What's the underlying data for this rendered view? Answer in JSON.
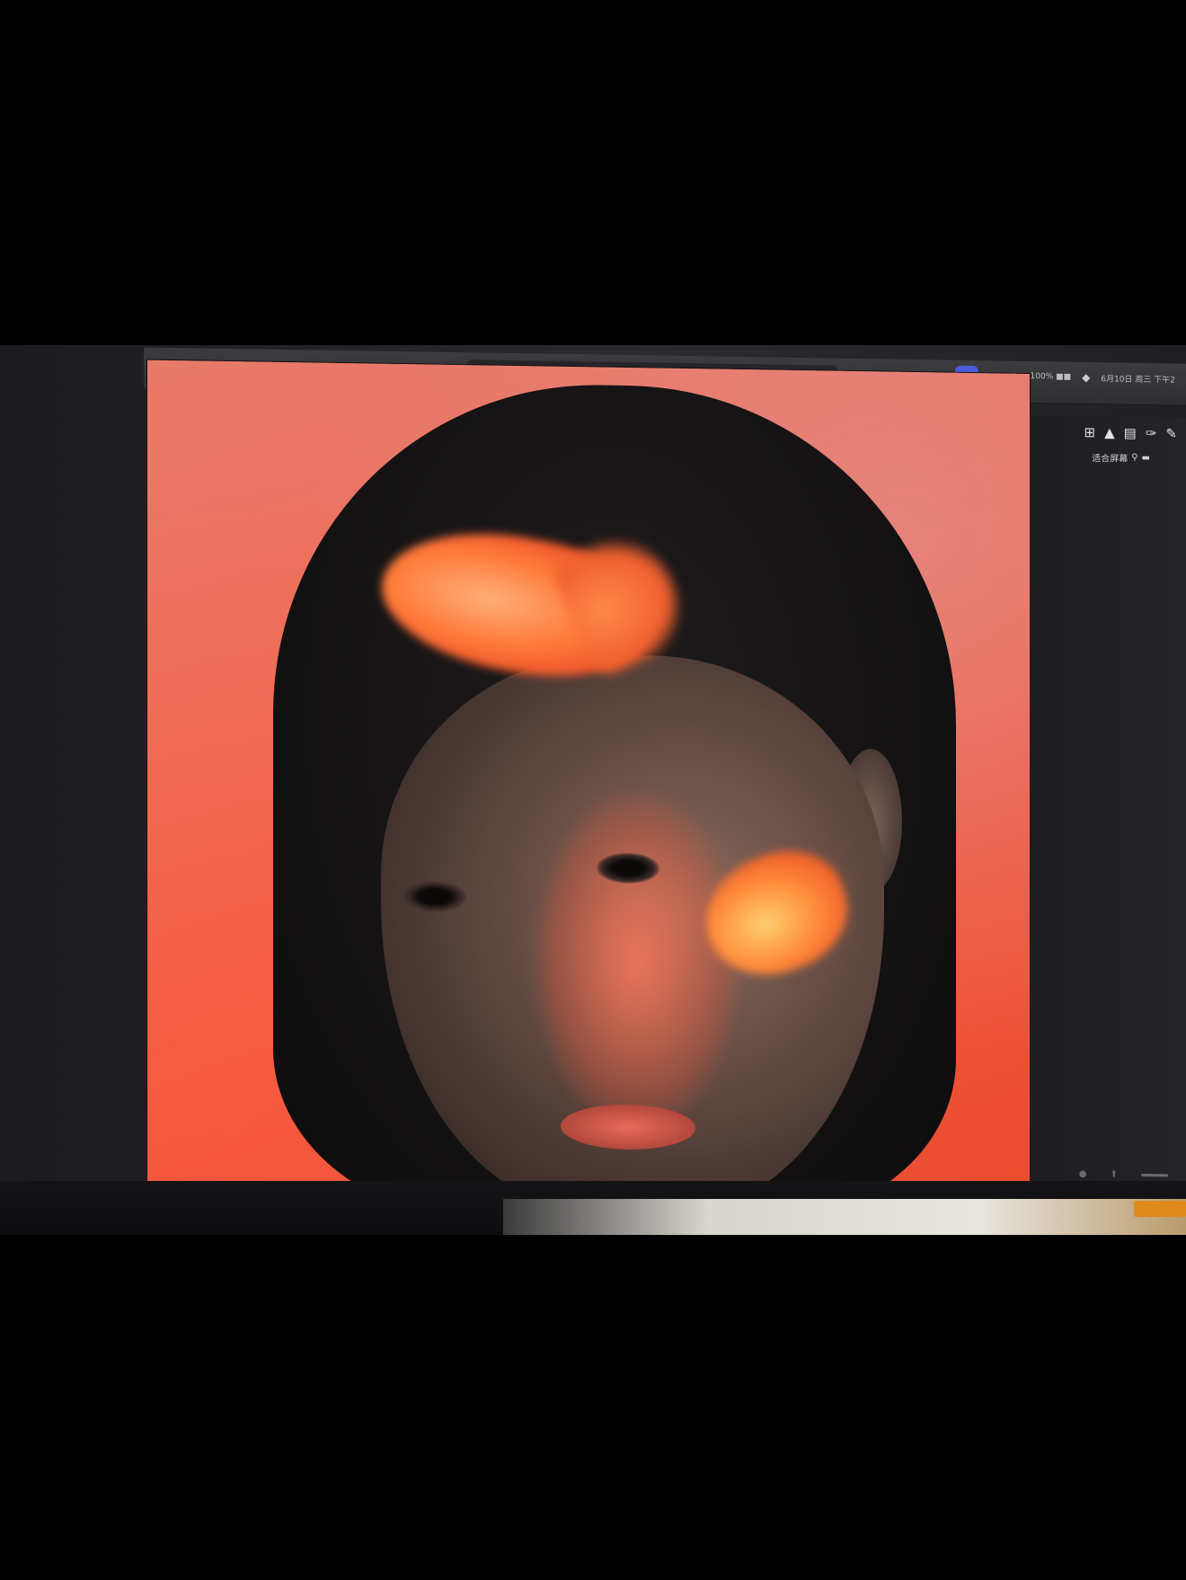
{
  "toolbar": {
    "tools": [
      {
        "icon": "move-select-icon",
        "glyph": "⬚"
      },
      {
        "icon": "lasso-icon",
        "glyph": "◌"
      },
      {
        "icon": "object-select-icon",
        "glyph": "⧉"
      },
      {
        "icon": "crop-icon",
        "glyph": "⊹"
      },
      {
        "icon": "eyedropper-icon",
        "glyph": "✎"
      },
      {
        "icon": "healing-icon",
        "glyph": "✚"
      },
      {
        "icon": "brush-icon",
        "glyph": "✐"
      },
      {
        "icon": "stamp-icon",
        "glyph": "⎔"
      },
      {
        "icon": "eraser-icon",
        "glyph": "⌫"
      },
      {
        "icon": "gradient-icon",
        "glyph": "▦"
      },
      {
        "icon": "pen-icon",
        "glyph": "✒"
      },
      {
        "icon": "smudge-icon",
        "glyph": "☝"
      }
    ]
  },
  "status": {
    "zoom": "100% ■■",
    "date": "6月10日 周三 下午2"
  },
  "subbar": {
    "fit_label": "适合屏幕"
  }
}
